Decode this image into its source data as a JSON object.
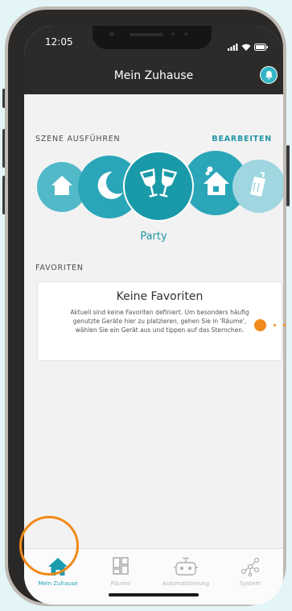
{
  "status_bar": {
    "time": "12:05",
    "icons": [
      "signal-icon",
      "wifi-icon",
      "battery-icon"
    ]
  },
  "header": {
    "title": "Mein Zuhause",
    "notification_icon": "bell-icon"
  },
  "scenes": {
    "section_label": "SZENE AUSFÜHREN",
    "edit_label": "BEARBEITEN",
    "active_label": "Party",
    "items": [
      {
        "icon": "home-icon",
        "active": false
      },
      {
        "icon": "moon-icon",
        "active": false
      },
      {
        "icon": "champagne-glasses-icon",
        "active": true
      },
      {
        "icon": "house-chimney-icon",
        "active": false
      },
      {
        "icon": "luggage-icon",
        "active": false
      }
    ]
  },
  "favorites": {
    "section_label": "FAVORITEN",
    "empty_title": "Keine Favoriten",
    "empty_text": "Aktuell sind keine Favoriten definiert. Um besonders häufig genutzte Geräte hier zu platzieren, gehen Sie in 'Räume', wählen Sie ein Gerät aus und tippen auf das Sternchen."
  },
  "tabbar": {
    "items": [
      {
        "label": "Mein Zuhause",
        "icon": "home-icon",
        "active": true
      },
      {
        "label": "Räume",
        "icon": "rooms-icon",
        "active": false
      },
      {
        "label": "Automatisierung",
        "icon": "robot-icon",
        "active": false
      },
      {
        "label": "System",
        "icon": "network-icon",
        "active": false
      }
    ]
  },
  "colors": {
    "accent": "#2196a6",
    "scene_light": "#9fd6e0",
    "scene_mid": "#40b2c4",
    "scene_active": "#1a9aa9",
    "highlight": "#f08a1a",
    "header_bg": "#2d2b29"
  }
}
